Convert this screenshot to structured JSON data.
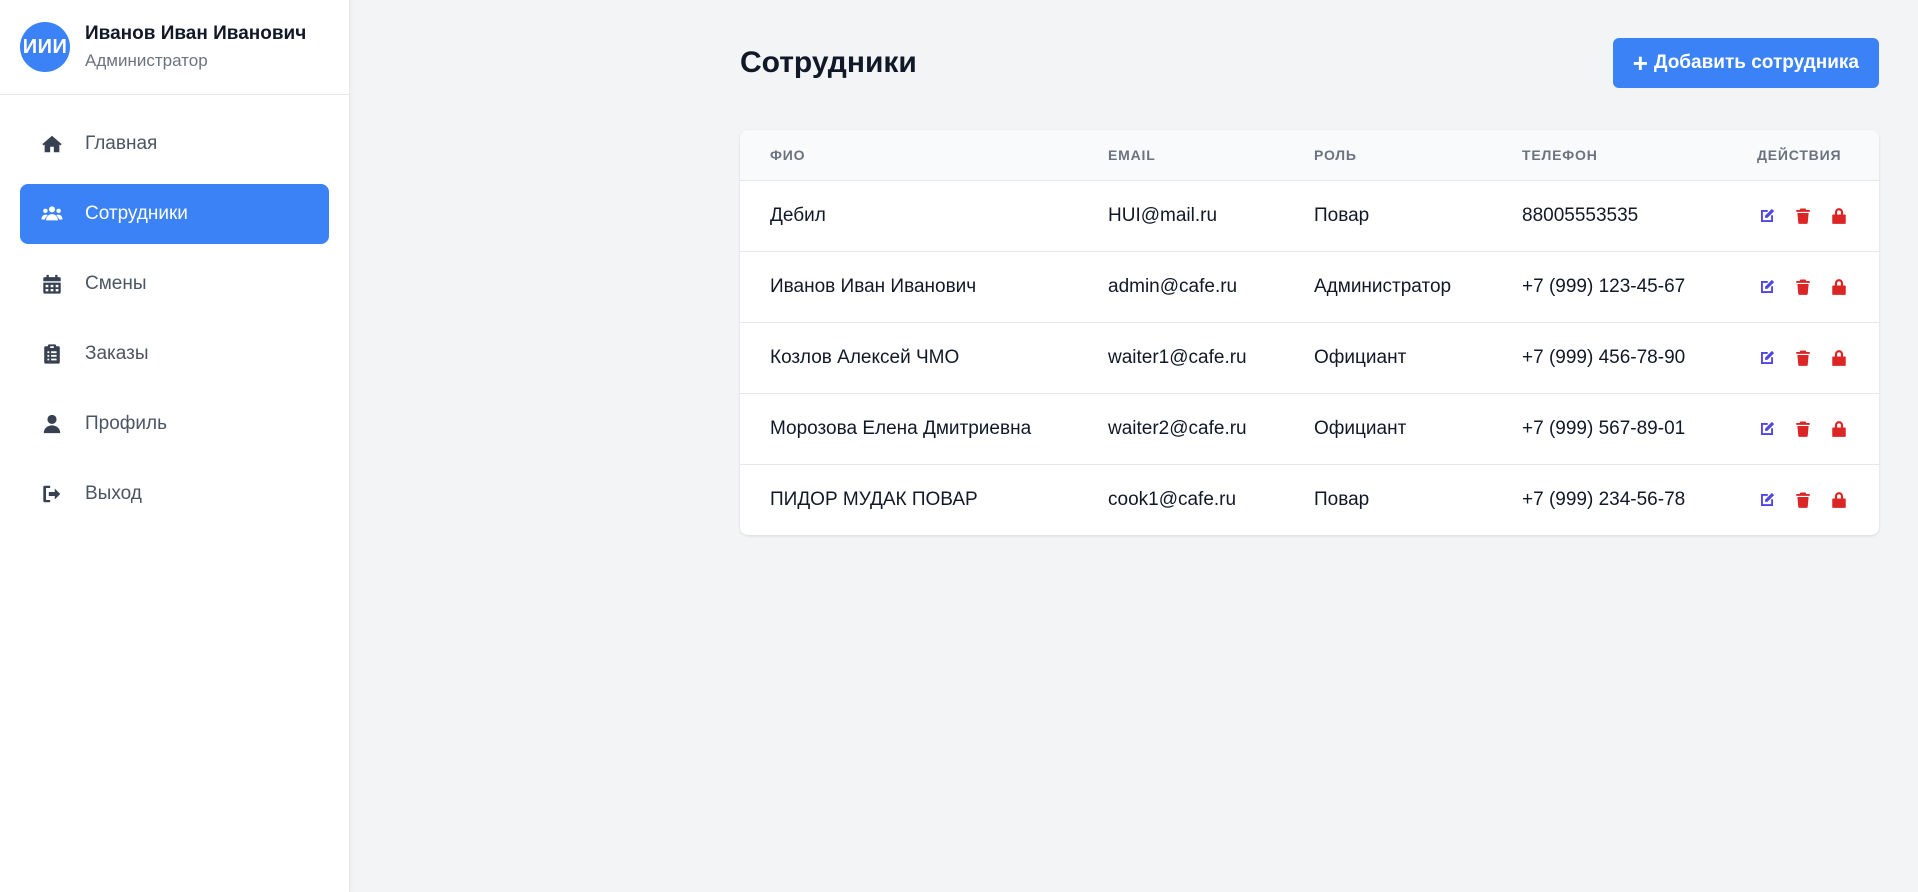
{
  "user": {
    "initials": "ИИИ",
    "name": "Иванов Иван Иванович",
    "role": "Администратор",
    "avatar_color": "#3b82f6"
  },
  "nav": {
    "items": [
      {
        "label": "Главная",
        "icon": "home-icon",
        "active": false
      },
      {
        "label": "Сотрудники",
        "icon": "users-icon",
        "active": true
      },
      {
        "label": "Смены",
        "icon": "calendar-icon",
        "active": false
      },
      {
        "label": "Заказы",
        "icon": "clipboard-icon",
        "active": false
      },
      {
        "label": "Профиль",
        "icon": "user-icon",
        "active": false
      },
      {
        "label": "Выход",
        "icon": "logout-icon",
        "active": false
      }
    ]
  },
  "page": {
    "title": "Сотрудники",
    "add_button_label": "Добавить сотрудника",
    "add_button_icon": "plus-icon"
  },
  "table": {
    "headers": [
      "ФИО",
      "EMAIL",
      "РОЛЬ",
      "ТЕЛЕФОН",
      "ДЕЙСТВИЯ"
    ],
    "rows": [
      {
        "name": "Дебил",
        "email": "HUI@mail.ru",
        "role": "Повар",
        "phone": "88005553535"
      },
      {
        "name": "Иванов Иван Иванович",
        "email": "admin@cafe.ru",
        "role": "Администратор",
        "phone": "+7 (999) 123-45-67"
      },
      {
        "name": "Козлов Алексей ЧМО",
        "email": "waiter1@cafe.ru",
        "role": "Официант",
        "phone": "+7 (999) 456-78-90"
      },
      {
        "name": "Морозова Елена Дмитриевна",
        "email": "waiter2@cafe.ru",
        "role": "Официант",
        "phone": "+7 (999) 567-89-01"
      },
      {
        "name": "ПИДОР МУДАК ПОВАР",
        "email": "cook1@cafe.ru",
        "role": "Повар",
        "phone": "+7 (999) 234-56-78"
      }
    ],
    "row_actions": [
      "edit-icon",
      "trash-icon",
      "lock-icon"
    ]
  },
  "colors": {
    "accent": "#3b82f6",
    "edit": "#4f46e5",
    "danger": "#dc2626"
  }
}
